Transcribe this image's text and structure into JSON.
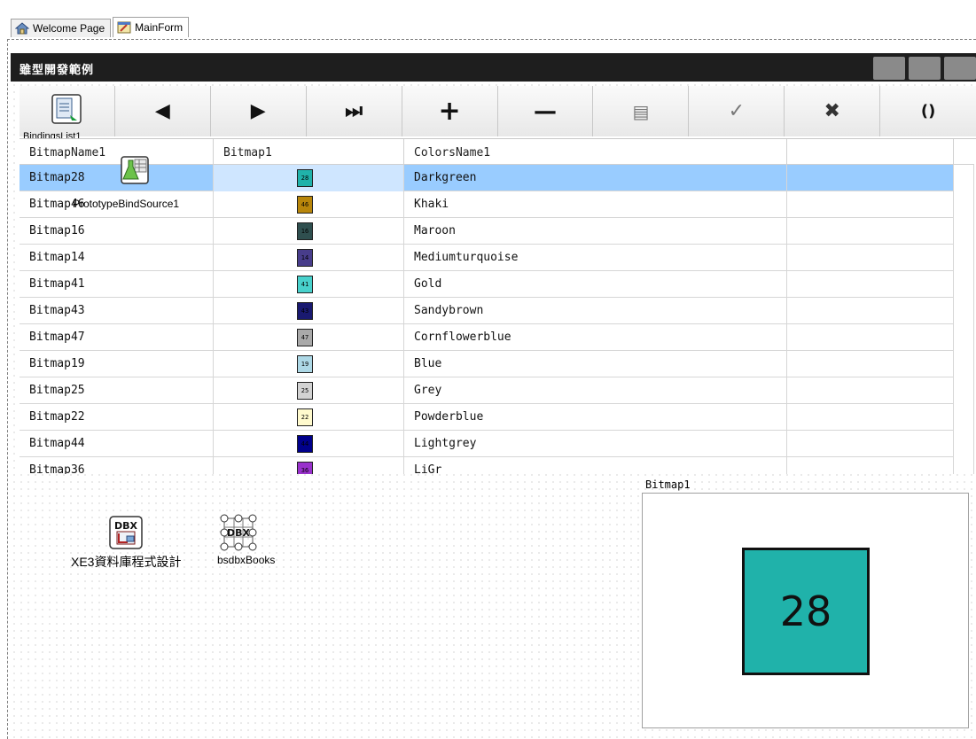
{
  "tabs": [
    {
      "label": "Welcome Page",
      "icon": "home-icon"
    },
    {
      "label": "MainForm",
      "icon": "form-icon"
    }
  ],
  "form": {
    "title": "雖型開發範例",
    "window_buttons": [
      "minimize-icon",
      "maximize-icon",
      "close-icon"
    ]
  },
  "navigator": {
    "buttons": [
      {
        "name": "bindings-list-button",
        "icon": "bindings-list-icon"
      },
      {
        "name": "prior-button",
        "glyph": "◀",
        "icon": "prior-icon"
      },
      {
        "name": "next-button",
        "glyph": "▶",
        "icon": "next-icon"
      },
      {
        "name": "last-button",
        "glyph": "⏭",
        "icon": "last-icon"
      },
      {
        "name": "insert-button",
        "glyph": "+",
        "icon": "plus-icon"
      },
      {
        "name": "delete-button",
        "glyph": "—",
        "icon": "minus-icon"
      },
      {
        "name": "edit-button",
        "glyph": "▤",
        "icon": "edit-icon"
      },
      {
        "name": "post-button",
        "glyph": "✓",
        "icon": "check-icon"
      },
      {
        "name": "cancel-button",
        "glyph": "✖",
        "icon": "cancel-icon"
      },
      {
        "name": "refresh-button",
        "glyph": "()",
        "icon": "refresh-icon"
      }
    ]
  },
  "components": {
    "bindings_list": "BindingsList1",
    "prototype_bind_source": "PrototypeBindSource1",
    "dbx_connection": "XE3資料庫程式設計",
    "dbx_dataset": "bsdbxBooks"
  },
  "grid": {
    "columns": [
      "BitmapName1",
      "Bitmap1",
      "ColorsName1",
      ""
    ],
    "rows": [
      {
        "name": "Bitmap28",
        "num": "28",
        "color": "#20b2aa",
        "color_name": "Darkgreen",
        "selected": true
      },
      {
        "name": "Bitmap46",
        "num": "46",
        "color": "#b8860b",
        "color_name": "Khaki"
      },
      {
        "name": "Bitmap16",
        "num": "16",
        "color": "#2f4f4f",
        "color_name": "Maroon"
      },
      {
        "name": "Bitmap14",
        "num": "14",
        "color": "#483d8b",
        "color_name": "Mediumturquoise"
      },
      {
        "name": "Bitmap41",
        "num": "41",
        "color": "#48d1cc",
        "color_name": "Gold"
      },
      {
        "name": "Bitmap43",
        "num": "43",
        "color": "#191970",
        "color_name": "Sandybrown"
      },
      {
        "name": "Bitmap47",
        "num": "47",
        "color": "#a9a9a9",
        "color_name": "Cornflowerblue"
      },
      {
        "name": "Bitmap19",
        "num": "19",
        "color": "#add8e6",
        "color_name": "Blue"
      },
      {
        "name": "Bitmap25",
        "num": "25",
        "color": "#d3d3d3",
        "color_name": "Grey"
      },
      {
        "name": "Bitmap22",
        "num": "22",
        "color": "#fffacd",
        "color_name": "Powderblue"
      },
      {
        "name": "Bitmap44",
        "num": "44",
        "color": "#00008b",
        "color_name": "Lightgrey"
      },
      {
        "name": "Bitmap36",
        "num": "36",
        "color": "#9932cc",
        "color_name": "LiGr"
      }
    ]
  },
  "image_panel": {
    "label": "Bitmap1",
    "value": "28",
    "color": "#20b2aa"
  }
}
